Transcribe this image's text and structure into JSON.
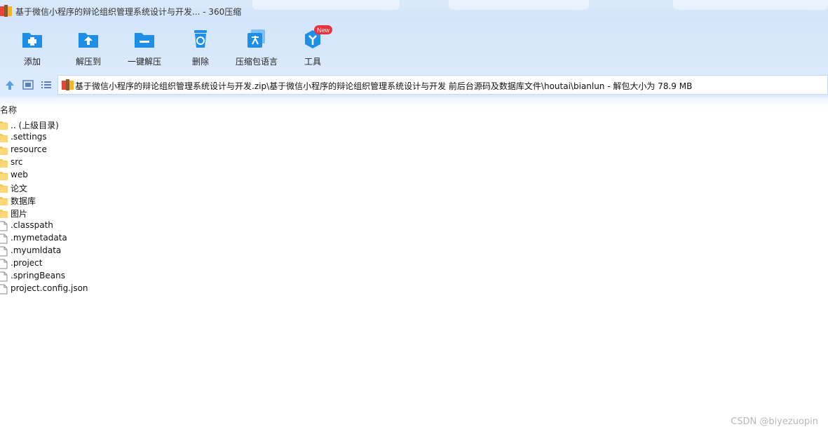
{
  "window": {
    "title": "基于微信小程序的辩论组织管理系统设计与开发... - 360压缩"
  },
  "toolbar": {
    "buttons": [
      {
        "label": "添加",
        "icon": "add-folder-icon"
      },
      {
        "label": "解压到",
        "icon": "extract-to-icon"
      },
      {
        "label": "一键解压",
        "icon": "one-click-extract-icon"
      },
      {
        "label": "删除",
        "icon": "recycle-bin-icon"
      },
      {
        "label": "压缩包语言",
        "icon": "archive-language-icon"
      },
      {
        "label": "工具",
        "icon": "tools-icon",
        "badge": "New"
      }
    ]
  },
  "address": {
    "path": "基于微信小程序的辩论组织管理系统设计与开发.zip\\基于微信小程序的辩论组织管理系统设计与开发 前后台源码及数据库文件\\houtai\\bianlun - 解包大小为 78.9 MB"
  },
  "list": {
    "column_name": "名称",
    "items": [
      {
        "name": ".. (上级目录)",
        "type": "folder"
      },
      {
        "name": ".settings",
        "type": "folder"
      },
      {
        "name": "resource",
        "type": "folder"
      },
      {
        "name": "src",
        "type": "folder"
      },
      {
        "name": "web",
        "type": "folder"
      },
      {
        "name": "论文",
        "type": "folder"
      },
      {
        "name": "数据库",
        "type": "folder"
      },
      {
        "name": "图片",
        "type": "folder"
      },
      {
        "name": ".classpath",
        "type": "file"
      },
      {
        "name": ".mymetadata",
        "type": "file"
      },
      {
        "name": ".myumldata",
        "type": "file"
      },
      {
        "name": ".project",
        "type": "file"
      },
      {
        "name": ".springBeans",
        "type": "file"
      },
      {
        "name": "project.config.json",
        "type": "file"
      }
    ]
  },
  "watermark": "CSDN @biyezuopin",
  "colors": {
    "accent": "#1e8fe6",
    "folder": "#f7c85a",
    "badge": "#e8333a"
  }
}
